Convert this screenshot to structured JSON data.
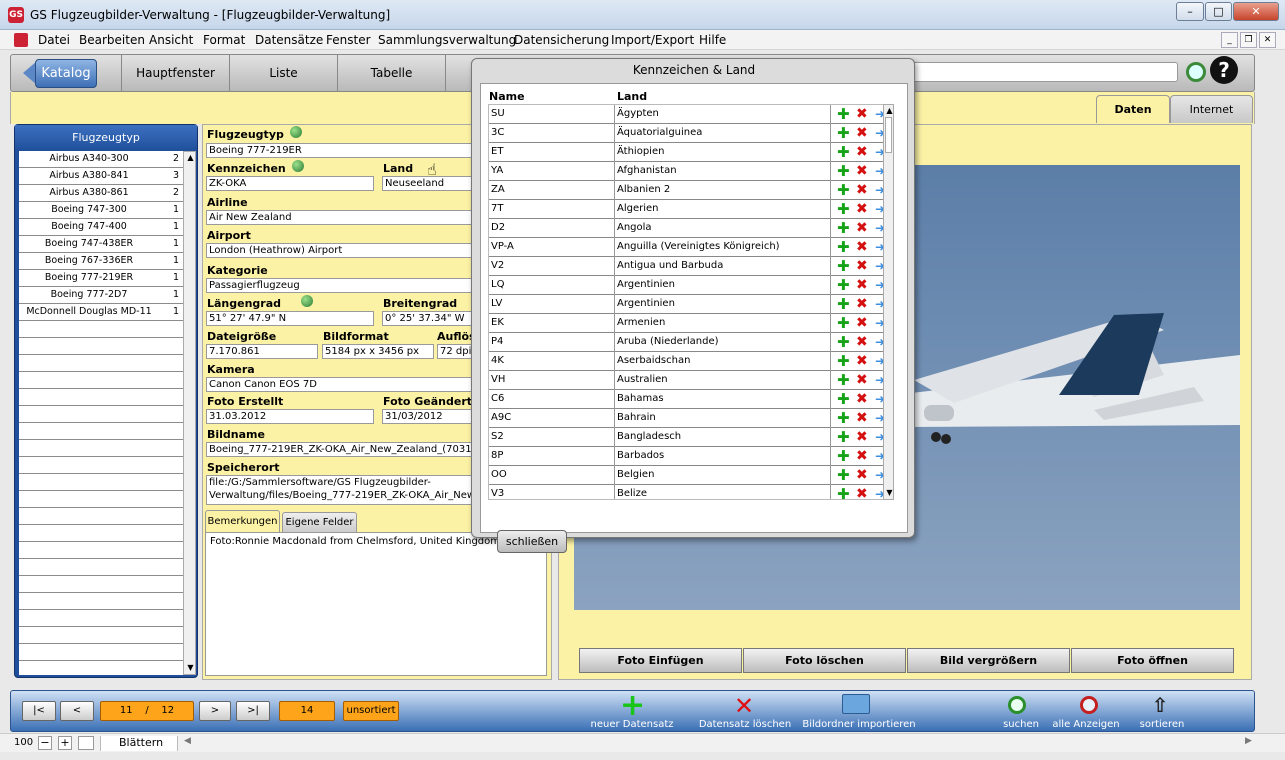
{
  "window": {
    "title": "GS Flugzeugbilder-Verwaltung - [Flugzeugbilder-Verwaltung]",
    "app_icon": "GS"
  },
  "menu": [
    "Datei",
    "Bearbeiten",
    "Ansicht",
    "Format",
    "Datensätze",
    "Fenster",
    "Sammlungsverwaltung",
    "Datensicherung",
    "Import/Export",
    "Hilfe"
  ],
  "nav": {
    "katalog": "Katalog",
    "tabs": [
      "Hauptfenster",
      "Liste",
      "Tabelle"
    ]
  },
  "right_tabs": [
    "Daten",
    "Internet"
  ],
  "left": {
    "header": "Flugzeugtyp",
    "items": [
      {
        "name": "Airbus A340-300",
        "count": "2"
      },
      {
        "name": "Airbus A380-841",
        "count": "3"
      },
      {
        "name": "Airbus A380-861",
        "count": "2"
      },
      {
        "name": "Boeing 747-300",
        "count": "1"
      },
      {
        "name": "Boeing 747-400",
        "count": "1"
      },
      {
        "name": "Boeing 747-438ER",
        "count": "1"
      },
      {
        "name": "Boeing 767-336ER",
        "count": "1"
      },
      {
        "name": "Boeing 777-219ER",
        "count": "1"
      },
      {
        "name": "Boeing 777-2D7",
        "count": "1"
      },
      {
        "name": "McDonnell Douglas MD-11",
        "count": "1"
      }
    ]
  },
  "form": {
    "flugzeugtyp_label": "Flugzeugtyp",
    "flugzeugtyp": "Boeing 777-219ER",
    "kennzeichen_label": "Kennzeichen",
    "kennzeichen": "ZK-OKA",
    "land_label": "Land",
    "land": "Neuseeland",
    "airline_label": "Airline",
    "airline": "Air New Zealand",
    "airport_label": "Airport",
    "airport": "London (Heathrow) Airport",
    "kategorie_label": "Kategorie",
    "kategorie": "Passagierflugzeug",
    "laengengrad_label": "Längengrad",
    "laengengrad": "51° 27' 47.9\" N",
    "breitengrad_label": "Breitengrad",
    "breitengrad": "0° 25' 37.34\" W",
    "dateigroesse_label": "Dateigröße",
    "dateigroesse": "7.170.861",
    "bildformat_label": "Bildformat",
    "bildformat": "5184 px x 3456 px",
    "aufloesung_label": "Auflös",
    "aufloesung": "72 dpi",
    "kamera_label": "Kamera",
    "kamera": "Canon Canon EOS 7D",
    "foto_erstellt_label": "Foto Erstellt",
    "foto_erstellt": "31.03.2012",
    "foto_geaendert_label": "Foto Geändert",
    "foto_geaendert": "31/03/2012",
    "bildname_label": "Bildname",
    "bildname": "Boeing_777-219ER_ZK-OKA_Air_New_Zealand_(7031",
    "speicherort_label": "Speicherort",
    "speicherort_1": "file:/G:/Sammlersoftware/GS Flugzeugbilder-",
    "speicherort_2": "Verwaltung/files/Boeing_777-219ER_ZK-OKA_Air_New",
    "tab_bemerkungen": "Bemerkungen",
    "tab_eigene": "Eigene Felder",
    "bemerkungen": "Foto:Ronnie Macdonald from Chelmsford, United Kingdom"
  },
  "photo_buttons": [
    "Foto Einfügen",
    "Foto löschen",
    "Bild vergrößern",
    "Foto öffnen"
  ],
  "bottom": {
    "first": "|<",
    "prev": "<",
    "record": "11",
    "sep": "/",
    "total": "12",
    "next": ">",
    "last": ">|",
    "count": "14",
    "sort_state": "unsortiert",
    "actions": [
      "neuer Datensatz",
      "Datensatz löschen",
      "Bildordner importieren",
      "suchen",
      "alle Anzeigen",
      "sortieren"
    ]
  },
  "status": {
    "zoom": "100",
    "mode": "Blättern"
  },
  "popup": {
    "title": "Kennzeichen & Land",
    "col_name": "Name",
    "col_land": "Land",
    "rows": [
      {
        "code": "SU",
        "land": "Ägypten"
      },
      {
        "code": "3C",
        "land": "Äquatorialguinea"
      },
      {
        "code": "ET",
        "land": "Äthiopien"
      },
      {
        "code": "YA",
        "land": "Afghanistan"
      },
      {
        "code": "ZA",
        "land": "Albanien 2"
      },
      {
        "code": "7T",
        "land": "Algerien"
      },
      {
        "code": "D2",
        "land": "Angola"
      },
      {
        "code": "VP-A",
        "land": "Anguilla (Vereinigtes Königreich)"
      },
      {
        "code": "V2",
        "land": "Antigua und Barbuda"
      },
      {
        "code": "LQ",
        "land": "Argentinien"
      },
      {
        "code": "LV",
        "land": "Argentinien"
      },
      {
        "code": "EK",
        "land": "Armenien"
      },
      {
        "code": "P4",
        "land": "Aruba (Niederlande)"
      },
      {
        "code": "4K",
        "land": "Aserbaidschan"
      },
      {
        "code": "VH",
        "land": "Australien"
      },
      {
        "code": "C6",
        "land": "Bahamas"
      },
      {
        "code": "A9C",
        "land": "Bahrain"
      },
      {
        "code": "S2",
        "land": "Bangladesch"
      },
      {
        "code": "8P",
        "land": "Barbados"
      },
      {
        "code": "OO",
        "land": "Belgien"
      },
      {
        "code": "V3",
        "land": "Belize"
      }
    ],
    "close": "schließen"
  }
}
